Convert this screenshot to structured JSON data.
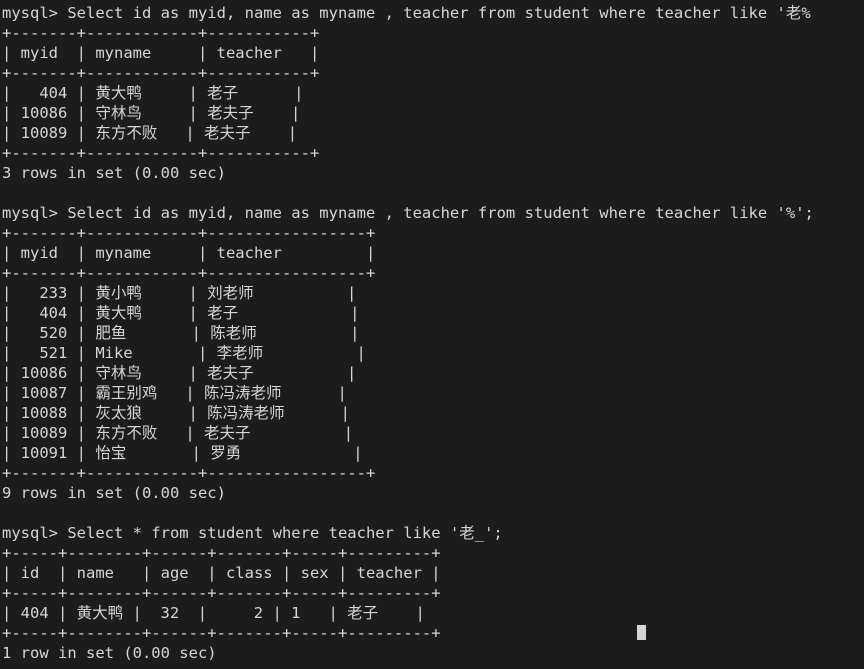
{
  "terminal": {
    "prompt": "mysql> ",
    "cursor_line_index": 31,
    "cursor_col": 68,
    "lines": [
      "mysql> Select id as myid, name as myname , teacher from student where teacher like '老%",
      "+-------+------------+-----------+",
      "| myid  | myname     | teacher   |",
      "+-------+------------+-----------+",
      "|   404 | 黄大鸭     | 老子      |",
      "| 10086 | 守林鸟     | 老夫子    |",
      "| 10089 | 东方不败   | 老夫子    |",
      "+-------+------------+-----------+",
      "3 rows in set (0.00 sec)",
      "",
      "mysql> Select id as myid, name as myname , teacher from student where teacher like '%';",
      "+-------+------------+-----------------+",
      "| myid  | myname     | teacher         |",
      "+-------+------------+-----------------+",
      "|   233 | 黄小鸭     | 刘老师          |",
      "|   404 | 黄大鸭     | 老子            |",
      "|   520 | 肥鱼       | 陈老师          |",
      "|   521 | Mike       | 李老师          |",
      "| 10086 | 守林鸟     | 老夫子          |",
      "| 10087 | 霸王别鸡   | 陈冯涛老师      |",
      "| 10088 | 灰太狼     | 陈冯涛老师      |",
      "| 10089 | 东方不败   | 老夫子          |",
      "| 10091 | 怡宝       | 罗勇            |",
      "+-------+------------+-----------------+",
      "9 rows in set (0.00 sec)",
      "",
      "mysql> Select * from student where teacher like '老_';",
      "+-----+--------+------+-------+-----+---------+",
      "| id  | name   | age  | class | sex | teacher |",
      "+-----+--------+------+-------+-----+---------+",
      "| 404 | 黄大鸭 |  32  |     2 | 1   | 老子    |",
      "+-----+--------+------+-------+-----+---------+",
      "1 row in set (0.00 sec)"
    ]
  },
  "colors": {
    "background": "#1c1c1c",
    "foreground": "#d6d6d6",
    "cursor": "#d6d6d6"
  }
}
